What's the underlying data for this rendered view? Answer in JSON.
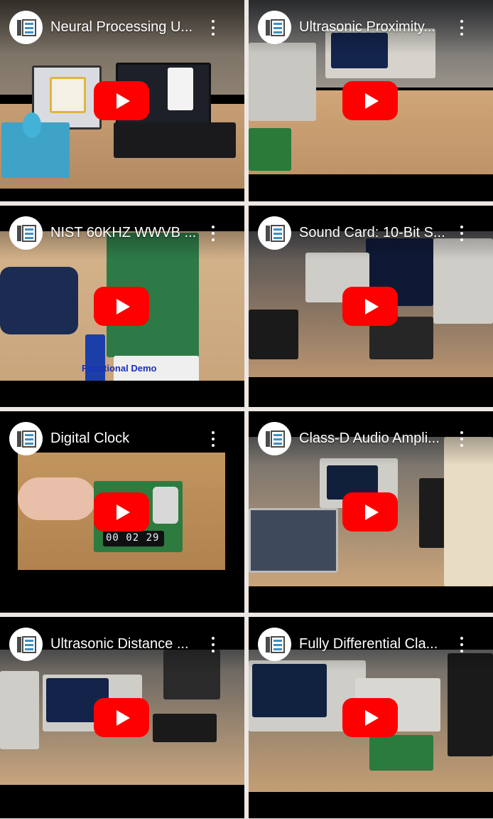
{
  "colors": {
    "page_bg": "#ece7e3",
    "card_bg": "#000000",
    "play_button": "#ff0000",
    "title_text": "#ffffff"
  },
  "icons": {
    "channel": "channel-logo-icon",
    "more": "more-vert-icon",
    "play": "youtube-play-icon"
  },
  "videos": [
    {
      "title": "Neural Processing U..."
    },
    {
      "title": "Ultrasonic Proximity..."
    },
    {
      "title": "NIST 60KHZ WWVB ..."
    },
    {
      "title": "Sound Card: 10-Bit S..."
    },
    {
      "title": "Digital Clock",
      "thumb_text": "00 02 29"
    },
    {
      "title": "Class-D Audio Ampli..."
    },
    {
      "title": "Ultrasonic Distance ..."
    },
    {
      "title": "Fully Differential Cla..."
    }
  ],
  "thumb_overlays": {
    "wwvb_demo": "Functional Demo"
  }
}
